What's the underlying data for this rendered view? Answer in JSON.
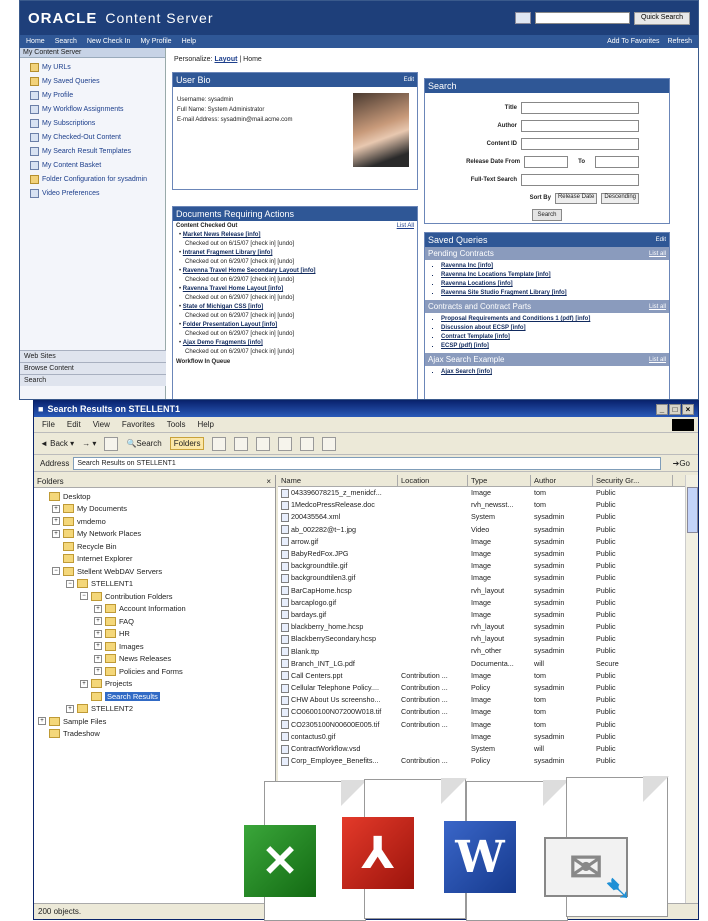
{
  "oracle": {
    "brand": "ORACLE",
    "product": "Content Server",
    "search_btn": "Quick Search",
    "nav": [
      "Home",
      "Search",
      "New Check In",
      "My Profile",
      "Help"
    ],
    "nav_right": [
      "Add To Favorites",
      "Refresh"
    ],
    "sidebar_title": "My Content Server",
    "sidebar": [
      "My URLs",
      "My Saved Queries",
      "My Profile",
      "My Workflow Assignments",
      "My Subscriptions",
      "My Checked-Out Content",
      "My Search Result Templates",
      "My Content Basket",
      "Folder Configuration for sysadmin",
      "Video Preferences"
    ],
    "accordions": [
      "Web Sites",
      "Browse Content",
      "Search"
    ],
    "personalize": "Personalize:",
    "layout": "Layout",
    "home": "Home",
    "bio": {
      "title": "User Bio",
      "edit": "Edit",
      "username": "Username: sysadmin",
      "fullname": "Full Name: System Administrator",
      "email": "E-mail Address: sysadmin@mail.acme.com"
    },
    "docs": {
      "title": "Documents Requiring Actions",
      "sub": "Content Checked Out",
      "list_all": "List All",
      "items": [
        {
          "t": "Market News Release [info]",
          "s": "Checked out on 6/15/07 [check in] [undo]"
        },
        {
          "t": "Intranet Fragment Library [info]",
          "s": "Checked out on 6/29/07 [check in] [undo]"
        },
        {
          "t": "Ravenna Travel Home Secondary Layout [info]",
          "s": "Checked out on 6/29/07 [check in] [undo]"
        },
        {
          "t": "Ravenna Travel Home Layout [info]",
          "s": "Checked out on 6/29/07 [check in] [undo]"
        },
        {
          "t": "State of Michigan CSS [info]",
          "s": "Checked out on 6/29/07 [check in] [undo]"
        },
        {
          "t": "Folder Presentation Layout [info]",
          "s": "Checked out on 6/29/07 [check in] [undo]"
        },
        {
          "t": "Ajax Demo Fragments [info]",
          "s": "Checked out on 6/29/07 [check in] [undo]"
        }
      ],
      "footer": "Workflow In Queue"
    },
    "search": {
      "title": "Search",
      "fields": [
        "Title",
        "Author",
        "Content ID",
        "Release Date From",
        "Full-Text Search"
      ],
      "to": "To",
      "sort_by": "Sort By",
      "sort_val": "Release Date",
      "order": "Descending",
      "btn": "Search"
    },
    "saved": {
      "title": "Saved Queries",
      "edit": "Edit",
      "groups": [
        {
          "name": "Pending Contracts",
          "list": "List all",
          "items": [
            "Ravenna Inc [info]",
            "Ravenna Inc Locations Template [info]",
            "Ravenna Locations [info]",
            "Ravenna Site Studio Fragment Library [info]"
          ]
        },
        {
          "name": "Contracts and Contract Parts",
          "list": "List all",
          "items": [
            "Proposal Requirements and Conditions 1 (pdf) [info]",
            "Discussion about ECSP [info]",
            "Contract Template [info]",
            "ECSP (pdf) [info]"
          ]
        },
        {
          "name": "Ajax Search Example",
          "list": "List all",
          "items": [
            "Ajax Search [info]"
          ]
        }
      ]
    }
  },
  "explorer": {
    "title": "Search Results on STELLENT1",
    "window_btns": [
      "_",
      "□",
      "×"
    ],
    "menu": [
      "File",
      "Edit",
      "View",
      "Favorites",
      "Tools",
      "Help"
    ],
    "toolbar": {
      "back": "Back",
      "search": "Search",
      "folders": "Folders"
    },
    "address_label": "Address",
    "address": "Search Results on STELLENT1",
    "go": "Go",
    "folders_title": "Folders",
    "tree": [
      {
        "d": 0,
        "l": "Desktop"
      },
      {
        "d": 1,
        "l": "My Documents",
        "e": "+"
      },
      {
        "d": 1,
        "l": "vmdemo",
        "e": "+"
      },
      {
        "d": 1,
        "l": "My Network Places",
        "e": "+"
      },
      {
        "d": 1,
        "l": "Recycle Bin"
      },
      {
        "d": 1,
        "l": "Internet Explorer"
      },
      {
        "d": 1,
        "l": "Stellent WebDAV Servers",
        "e": "−"
      },
      {
        "d": 2,
        "l": "STELLENT1",
        "e": "−"
      },
      {
        "d": 3,
        "l": "Contribution Folders",
        "e": "−"
      },
      {
        "d": 4,
        "l": "Account Information",
        "e": "+"
      },
      {
        "d": 4,
        "l": "FAQ",
        "e": "+"
      },
      {
        "d": 4,
        "l": "HR",
        "e": "+"
      },
      {
        "d": 4,
        "l": "Images",
        "e": "+"
      },
      {
        "d": 4,
        "l": "News Releases",
        "e": "+"
      },
      {
        "d": 4,
        "l": "Policies and Forms",
        "e": "+"
      },
      {
        "d": 3,
        "l": "Projects",
        "e": "+"
      },
      {
        "d": 3,
        "l": "Search Results",
        "hl": true
      },
      {
        "d": 2,
        "l": "STELLENT2",
        "e": "+"
      },
      {
        "d": 0,
        "l": "Sample Files",
        "e": "+"
      },
      {
        "d": 0,
        "l": "Tradeshow"
      }
    ],
    "columns": [
      "Name",
      "Location",
      "Type",
      "Author",
      "Security Gr..."
    ],
    "rows": [
      [
        "043396078215_z_menidcf...",
        "",
        "Image",
        "tom",
        "Public"
      ],
      [
        "1MedcoPressRelease.doc",
        "",
        "rvh_newsst...",
        "tom",
        "Public"
      ],
      [
        "200435564.xml",
        "",
        "System",
        "sysadmin",
        "Public"
      ],
      [
        "ab_002282@t~1.jpg",
        "",
        "Video",
        "sysadmin",
        "Public"
      ],
      [
        "arrow.gif",
        "",
        "Image",
        "sysadmin",
        "Public"
      ],
      [
        "BabyRedFox.JPG",
        "",
        "Image",
        "sysadmin",
        "Public"
      ],
      [
        "backgroundtile.gif",
        "",
        "Image",
        "sysadmin",
        "Public"
      ],
      [
        "backgroundtilen3.gif",
        "",
        "Image",
        "sysadmin",
        "Public"
      ],
      [
        "BarCapHome.hcsp",
        "",
        "rvh_layout",
        "sysadmin",
        "Public"
      ],
      [
        "barcaplogo.gif",
        "",
        "Image",
        "sysadmin",
        "Public"
      ],
      [
        "bardays.gif",
        "",
        "Image",
        "sysadmin",
        "Public"
      ],
      [
        "blackberry_home.hcsp",
        "",
        "rvh_layout",
        "sysadmin",
        "Public"
      ],
      [
        "BlackberrySecondary.hcsp",
        "",
        "rvh_layout",
        "sysadmin",
        "Public"
      ],
      [
        "Blank.ttp",
        "",
        "rvh_other",
        "sysadmin",
        "Public"
      ],
      [
        "Branch_INT_LG.pdf",
        "",
        "Documenta...",
        "will",
        "Secure"
      ],
      [
        "Call Centers.ppt",
        "Contribution ...",
        "Image",
        "tom",
        "Public"
      ],
      [
        "Cellular Telephone Policy....",
        "Contribution ...",
        "Policy",
        "sysadmin",
        "Public"
      ],
      [
        "CHW About Us screensho...",
        "Contribution ...",
        "Image",
        "tom",
        "Public"
      ],
      [
        "CO0600100N07200W018.tif",
        "Contribution ...",
        "Image",
        "tom",
        "Public"
      ],
      [
        "CO2305100N00600E005.tif",
        "Contribution ...",
        "Image",
        "tom",
        "Public"
      ],
      [
        "contactus0.gif",
        "",
        "Image",
        "sysadmin",
        "Public"
      ],
      [
        "ContractWorkflow.vsd",
        "",
        "System",
        "will",
        "Public"
      ],
      [
        "Corp_Employee_Benefits...",
        "Contribution ...",
        "Policy",
        "sysadmin",
        "Public"
      ]
    ],
    "status": "200 objects."
  }
}
